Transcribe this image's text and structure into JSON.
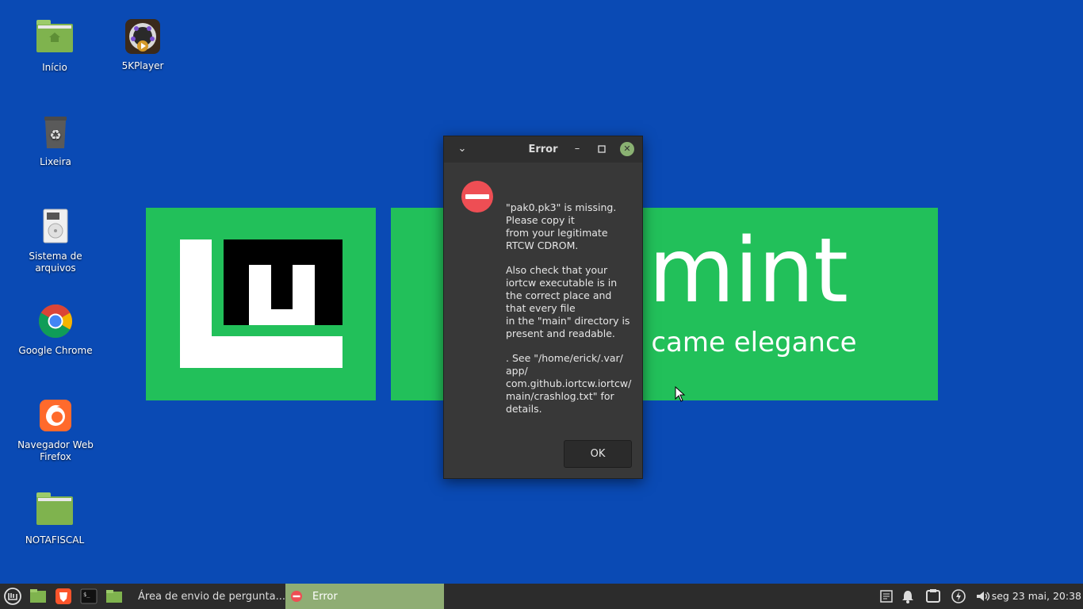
{
  "wallpaper": {
    "big_text": "x mint",
    "tagline": "n came elegance"
  },
  "desktop_icons": [
    {
      "label": "Início"
    },
    {
      "label": "5KPlayer"
    },
    {
      "label": "Lixeira"
    },
    {
      "label": "Sistema de arquivos"
    },
    {
      "label": "Google Chrome"
    },
    {
      "label": "Navegador Web Firefox"
    },
    {
      "label": "NOTAFISCAL"
    }
  ],
  "dialog": {
    "title": "Error",
    "paragraphs": [
      "\"pak0.pk3\" is missing.\nPlease copy it\nfrom your legitimate\nRTCW CDROM.",
      "Also check that your\niortcw executable is in\nthe correct place and\nthat every file\nin the \"main\" directory is\npresent and readable.",
      ". See \"/home/erick/.var/\napp/\ncom.github.iortcw.iortcw/\nmain/crashlog.txt\" for\ndetails."
    ],
    "ok_label": "OK",
    "colors": {
      "error": "#ee4e54",
      "close_button": "#8ab172"
    }
  },
  "taskbar": {
    "windows": [
      {
        "label": "Área de envio de pergunta..."
      },
      {
        "label": "Error"
      }
    ],
    "clock": "seg 23 mai, 20:38",
    "accent_color": "#8fad74"
  }
}
